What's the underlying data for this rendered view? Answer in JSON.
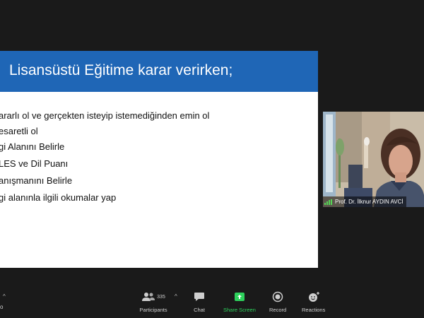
{
  "slide": {
    "title": "Lisansüstü Eğitime karar verirken;",
    "bullets": [
      "ararlı ol ve gerçekten isteyip istemediğinden emin ol",
      "esaretli ol",
      "gi Alanını Belirle",
      "LES ve Dil Puanı",
      "anışmanını Belirle",
      "gi alanınla ilgili okumalar yap"
    ]
  },
  "video": {
    "participant_name": "Prof. Dr. İlknur AYDIN AVCİ"
  },
  "toolbar": {
    "participants_label": "Participants",
    "participants_count": "335",
    "chat_label": "Chat",
    "share_screen_label": "Share Screen",
    "record_label": "Record",
    "reactions_label": "Reactions",
    "left_partial_label": "o"
  },
  "colors": {
    "slide_header": "#1f66b6",
    "share_screen_accent": "#2ed15c",
    "background": "#1a1a1a"
  }
}
